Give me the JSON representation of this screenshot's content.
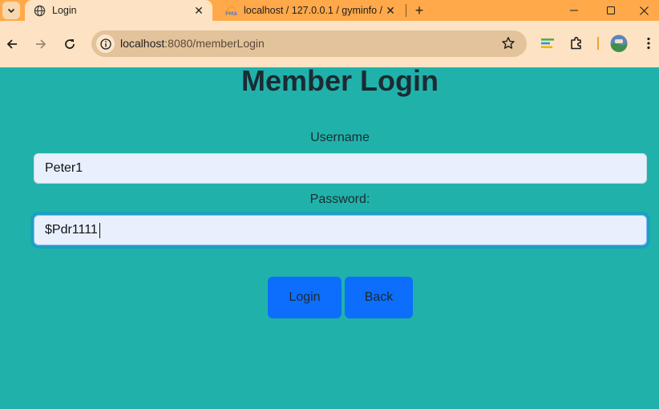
{
  "browser": {
    "tabs": [
      {
        "title": "Login",
        "active": true
      },
      {
        "title": "localhost / 127.0.0.1 / gyminfo /",
        "active": false
      }
    ],
    "address": {
      "host": "localhost",
      "path": ":8080/memberLogin"
    }
  },
  "page": {
    "title": "Member Login",
    "username_label": "Username",
    "username_value": "Peter1",
    "password_label": "Password:",
    "password_value": "$Pdr1111",
    "login_label": "Login",
    "back_label": "Back"
  },
  "colors": {
    "page_background": "#20b2aa",
    "button": "#0d6efd",
    "input_background": "#e8f0fe",
    "tab_strip": "#ffa94a",
    "toolbar": "#fde3c3"
  }
}
